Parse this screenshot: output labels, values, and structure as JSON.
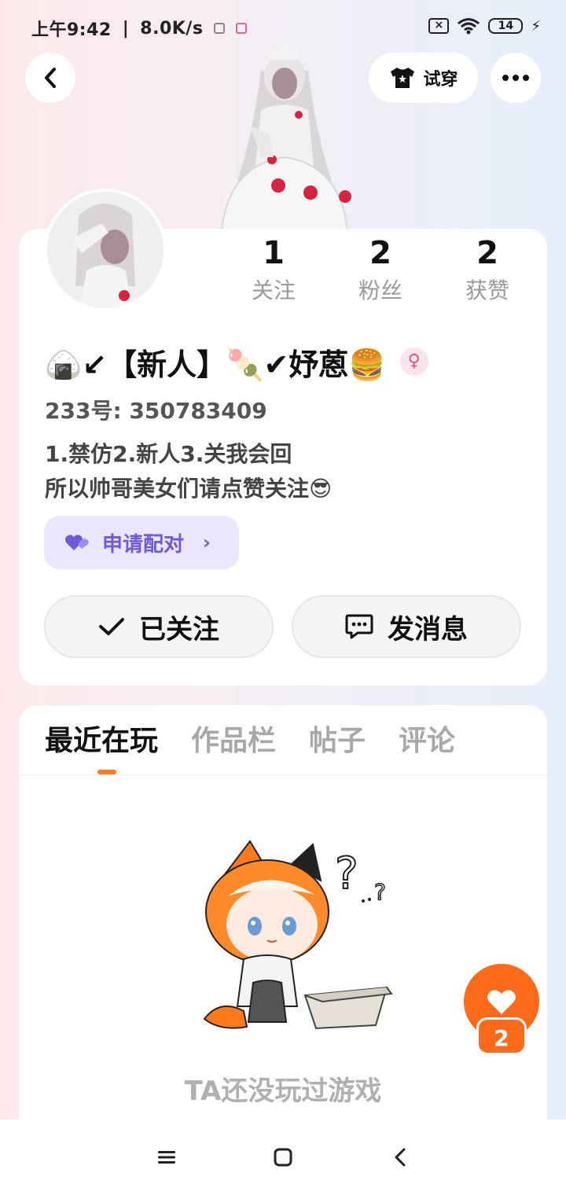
{
  "status_bar": {
    "time": "上午9:42",
    "speed": "8.0K/s",
    "battery": "14"
  },
  "header": {
    "back_icon": "chevron-left-icon",
    "tryon_label": "试穿",
    "more_icon": "ellipsis-icon"
  },
  "profile": {
    "stats": [
      {
        "value": "1",
        "label": "关注"
      },
      {
        "value": "2",
        "label": "粉丝"
      },
      {
        "value": "2",
        "label": "获赞"
      }
    ],
    "name": "🍙↙【新人】🍡✔妤蒽🍔",
    "gender_symbol": "♀",
    "uid": "233号: 350783409",
    "bio_lines": [
      "1.禁仿2.新人3.关我会回",
      "所以帅哥美女们请点赞关注😎"
    ],
    "pair_label": "申请配对",
    "follow_label": "已关注",
    "message_label": "发消息"
  },
  "tabs": {
    "items": [
      "最近在玩",
      "作品栏",
      "帖子",
      "评论"
    ],
    "active_index": 0
  },
  "empty_state": {
    "text": "TA还没玩过游戏"
  },
  "float_like": {
    "count": "2"
  },
  "colors": {
    "accent": "#ff7a1a",
    "pair_bg": "#ebe6fb",
    "pair_text": "#6f5bd9"
  }
}
